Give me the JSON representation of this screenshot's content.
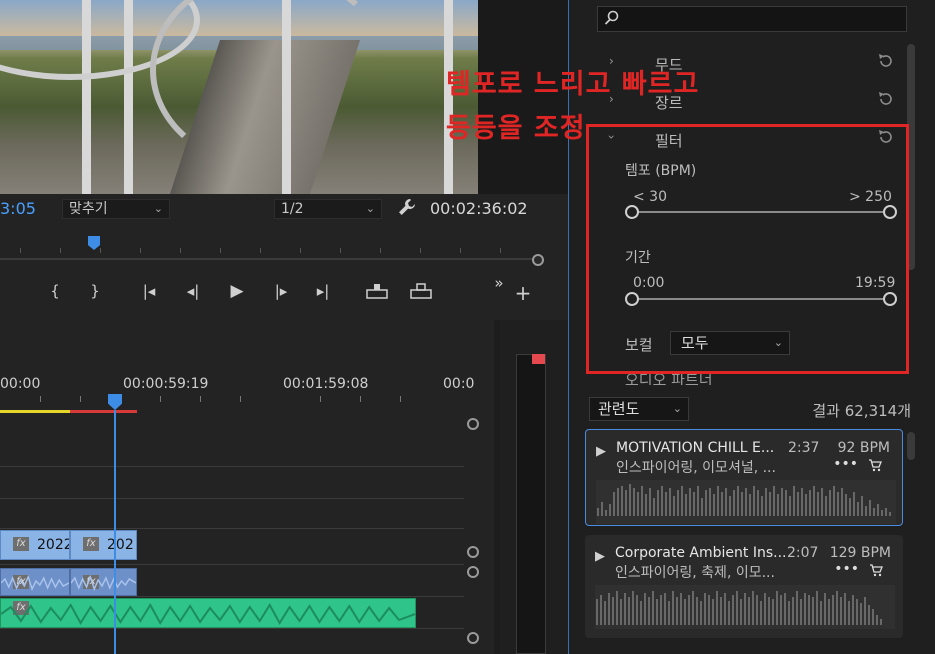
{
  "monitor": {
    "timecode_left": "3:05",
    "fit_dropdown": "맞추기",
    "resolution_dropdown": "1/2",
    "timecode_right": "00:02:36:02",
    "transport_more": "»"
  },
  "timeline": {
    "ruler_times": [
      "00:00",
      "00:00:59:19",
      "00:01:59:08",
      "00:0"
    ],
    "clip_labels": [
      "2022",
      "202"
    ]
  },
  "panel": {
    "search_placeholder": "",
    "sections": [
      {
        "label": "무드"
      },
      {
        "label": "장르"
      },
      {
        "label": "필터"
      }
    ],
    "filter": {
      "tempo_label": "템포 (BPM)",
      "tempo_min": "< 30",
      "tempo_max": "> 250",
      "duration_label": "기간",
      "duration_min": "0:00",
      "duration_max": "19:59",
      "vocal_label": "보컬",
      "vocal_value": "모두"
    },
    "partial_section": "오디오 파트너",
    "sort_value": "관련도",
    "results_count": "결과 62,314개",
    "tracks": [
      {
        "title": "MOTIVATION CHILL E...",
        "duration": "2:37",
        "bpm": "92 BPM",
        "tags": "인스파이어링, 이모셔널, ...",
        "more": "•••"
      },
      {
        "title": "Corporate Ambient Ins...",
        "duration": "2:07",
        "bpm": "129 BPM",
        "tags": "인스파이어링, 축제, 이모...",
        "more": "•••"
      }
    ]
  },
  "overlay": {
    "line1": "템포로 느리고 빠르고",
    "line2": "등등을 조정"
  },
  "colors": {
    "accent_blue": "#3d8de6",
    "highlight_red": "#e02525",
    "audio_green": "#2ec48a",
    "video_clip": "#8bb4e6"
  }
}
